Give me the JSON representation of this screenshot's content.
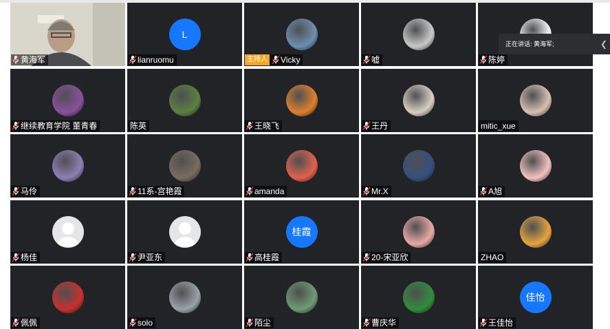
{
  "speaking_banner": "正在讲话: 黄海军;",
  "host_badge": "主持人",
  "participants": [
    {
      "name": "黄海军",
      "avatar": "video",
      "mic": true
    },
    {
      "name": "lianruomu",
      "avatar": "letter",
      "letter": "L",
      "mic": true
    },
    {
      "name": "Vicky",
      "avatar": "photo",
      "color": "#6e8fb0",
      "mic": true,
      "host": true
    },
    {
      "name": "嘘",
      "avatar": "photo",
      "color": "#c9c9c9",
      "mic": true
    },
    {
      "name": "陈婷",
      "avatar": "photo",
      "color": "#f3f3f3",
      "mic": true
    },
    {
      "name": "继续教育学院 董青春",
      "avatar": "photo",
      "color": "#8a4f9d",
      "mic": true
    },
    {
      "name": "陈英",
      "avatar": "photo",
      "color": "#5c7f3f",
      "mic": false
    },
    {
      "name": "王晓飞",
      "avatar": "photo",
      "color": "#e0802c",
      "mic": true
    },
    {
      "name": "王丹",
      "avatar": "photo",
      "color": "#d8cfc4",
      "mic": true
    },
    {
      "name": "mitic_xue",
      "avatar": "photo",
      "color": "#d9c0b2",
      "mic": false
    },
    {
      "name": "马伶",
      "avatar": "photo",
      "color": "#8d7fb3",
      "mic": true
    },
    {
      "name": "11系-宫艳霞",
      "avatar": "photo",
      "color": "#7a6b5e",
      "mic": true
    },
    {
      "name": "amanda",
      "avatar": "photo",
      "color": "#e0624b",
      "mic": true
    },
    {
      "name": "Mr.X",
      "avatar": "photo",
      "color": "#35507d",
      "mic": true
    },
    {
      "name": "A旭",
      "avatar": "photo",
      "color": "#f1c2bf",
      "mic": true
    },
    {
      "name": "杨佳",
      "avatar": "gray",
      "mic": true
    },
    {
      "name": "尹亚东",
      "avatar": "gray",
      "mic": true
    },
    {
      "name": "高桂霞",
      "avatar": "letter",
      "letter": "桂霞",
      "mic": true
    },
    {
      "name": "20-宋亚欣",
      "avatar": "photo",
      "color": "#e8a9a4",
      "mic": true
    },
    {
      "name": "ZHAO",
      "avatar": "photo",
      "color": "#e4a43e",
      "mic": false
    },
    {
      "name": "佩佩",
      "avatar": "photo",
      "color": "#c9302c",
      "mic": true
    },
    {
      "name": "solo",
      "avatar": "photo",
      "color": "#9aa3a8",
      "mic": true
    },
    {
      "name": "陌尘",
      "avatar": "photo",
      "color": "#6f9a73",
      "mic": true
    },
    {
      "name": "曹庆华",
      "avatar": "photo",
      "color": "#2f8d3a",
      "mic": true
    },
    {
      "name": "王佳怡",
      "avatar": "letter",
      "letter": "佳怡",
      "mic": true
    }
  ]
}
